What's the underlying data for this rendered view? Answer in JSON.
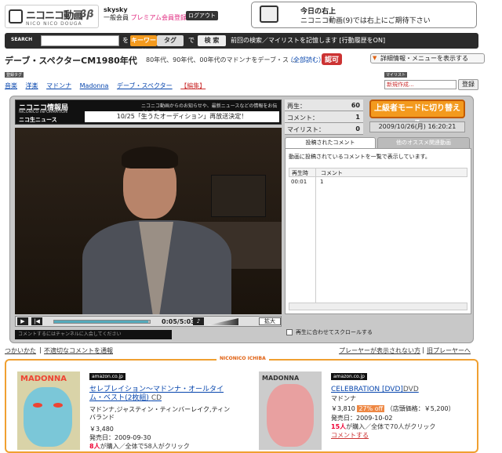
{
  "header": {
    "logo_text": "ニコニコ動画",
    "logo_sub": "NICO NICO DOUGA",
    "logo_version": "ββ",
    "username": "skysky",
    "member_type": "一般会員",
    "premium_link": "プレミアム会員登録へ",
    "logout": "ログアウト",
    "notice_title": "今日の右上",
    "notice_text": "ニコニコ動画(9)では右上にご期待下さい"
  },
  "search": {
    "label": "SEARCH",
    "wo": "を",
    "keyword_tab": "キーワード",
    "tag_tab": "タグ",
    "de": "で",
    "button": "検 索",
    "remember": "前回の検索／マイリストを記憶します [行動履歴をON]"
  },
  "video": {
    "title": "デーブ・スペクターCM1980年代",
    "description": "80年代、90年代、00年代のマドンナをデーブ・ス ...",
    "read_all": "（全部読む）",
    "lock_badge": "認可",
    "detail_button": "詳細情報・メニューを表示する"
  },
  "tags": {
    "label": "登録タグ",
    "items": [
      "音楽",
      "洋楽",
      "マドンナ",
      "Madonna",
      "デーブ・スペクター"
    ],
    "edit": "【編集】"
  },
  "mylist": {
    "label": "マイリスト",
    "select_value": "新規作成...",
    "register": "登録"
  },
  "player": {
    "info_brand": "ニコニコ情報局",
    "info_brand_sub": "NICONICO INFORMATION",
    "news_badge": "ニコ生ニュース",
    "ticker": "ニコニコ動画からのお知らせや、最新ニュースなどの情報をお伝えします",
    "headline": "10/25「生うたオーディション」再放送決定！",
    "time_current": "0:05/",
    "time_total": "5:03",
    "zoom": "拡大",
    "channel_link": "コメントするにはチャンネルに入会してください",
    "progress": 0.98
  },
  "stats": {
    "views_label": "再生：",
    "views": "60",
    "comments_label": "コメント：",
    "comments": "1",
    "mylist_label": "マイリスト：",
    "mylist": "0",
    "upgrade_button": "上級者モードに切り替える",
    "datetime": "2009/10/26(月) 16:20:21"
  },
  "comments": {
    "tab_posted": "投稿されたコメント",
    "tab_other": "他のオススメ関連動画",
    "description": "動画に投稿されているコメントを一覧で表示しています。",
    "col_time": "再生時",
    "col_comment": "コメント",
    "rows": [
      {
        "time": "00:01",
        "comment": "1"
      }
    ],
    "autoscroll": "再生に合わせてスクロールする"
  },
  "links": {
    "howto": "つかいかた",
    "report": "不適切なコメントを通報",
    "player_issue": "プレーヤーが表示されない方",
    "old_player": "旧プレーヤーへ",
    "separator": "|"
  },
  "ichiba": {
    "label": "NICONICO ICHIBA",
    "items": [
      {
        "badge": "amazon.co.jp",
        "cover_text": "MADONNA",
        "title": "セレブレイション～マドンナ・オールタイム・ベスト(2枚組)",
        "media": "CD",
        "artist": "マドンナ,ジャスティン・ティンバーレイク,ティンバランド",
        "price": "￥3,480",
        "release": "発売日：2009-09-30",
        "buyers": "8人",
        "buyers_rest": "が購入／全体で58人がクリック"
      },
      {
        "badge": "amazon.co.jp",
        "cover_text": "MADONNA",
        "title": "CELEBRATION [DVD]",
        "media": "DVD",
        "artist": "マドンナ",
        "price": "￥3,810",
        "discount": "27% off",
        "list_price": "（店頭価格：￥5,200）",
        "release": "発売日：2009-10-02",
        "buyers": "15人",
        "buyers_rest": "が購入／全体で70人がクリック",
        "comment_link": "コメントする"
      }
    ]
  }
}
